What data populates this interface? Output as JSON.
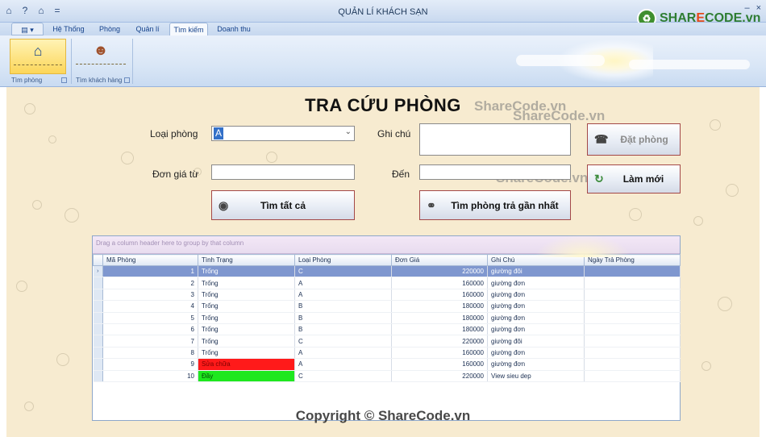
{
  "window": {
    "title": "QUẢN LÍ KHÁCH SẠN"
  },
  "logo": {
    "text_a": "SHAR",
    "text_o": "E",
    "text_b": "CODE.vn"
  },
  "ribbon_tabs": [
    {
      "label": "Hệ Thống"
    },
    {
      "label": "Phòng"
    },
    {
      "label": "Quản lí"
    },
    {
      "label": "Tìm kiếm"
    },
    {
      "label": "Doanh thu"
    }
  ],
  "ribbon": {
    "group1_label": "Tìm phòng",
    "group2_label": "Tìm khách hàng"
  },
  "form": {
    "heading": "TRA CỨU PHÒNG",
    "loai_phong_label": "Loại phòng",
    "loai_phong_value": "A",
    "ghi_chu_label": "Ghi chú",
    "don_gia_tu_label": "Đơn giá từ",
    "den_label": "Đến",
    "don_gia_tu_value": "",
    "den_value": "",
    "ghi_chu_value": ""
  },
  "buttons": {
    "dat_phong": "Đặt phòng",
    "lam_moi": "Làm mới",
    "tim_tat_ca": "Tìm tất cả",
    "tim_phong_tra_gan_nhat": "Tìm phòng trả gần nhất"
  },
  "watermarks": {
    "w1": "ShareCode.vn",
    "w2": "ShareCode.vn",
    "w3": "ShareCode.vn",
    "copyright": "Copyright © ShareCode.vn"
  },
  "grid": {
    "group_panel_text": "Drag a column header here to group by that column",
    "columns": [
      "Mã Phòng",
      "Tình Trạng",
      "Loại Phòng",
      "Đơn Giá",
      "Ghi Chú",
      "Ngày Trả Phòng"
    ],
    "rows": [
      {
        "ma": "1",
        "tinh_trang": "Trống",
        "loai": "C",
        "gia": "220000",
        "ghi_chu": "giường đôi",
        "ngay_tra": ""
      },
      {
        "ma": "2",
        "tinh_trang": "Trống",
        "loai": "A",
        "gia": "160000",
        "ghi_chu": "giường đơn",
        "ngay_tra": ""
      },
      {
        "ma": "3",
        "tinh_trang": "Trống",
        "loai": "A",
        "gia": "160000",
        "ghi_chu": "giường đơn",
        "ngay_tra": ""
      },
      {
        "ma": "4",
        "tinh_trang": "Trống",
        "loai": "B",
        "gia": "180000",
        "ghi_chu": "giường đơn",
        "ngay_tra": ""
      },
      {
        "ma": "5",
        "tinh_trang": "Trống",
        "loai": "B",
        "gia": "180000",
        "ghi_chu": "giường đơn",
        "ngay_tra": ""
      },
      {
        "ma": "6",
        "tinh_trang": "Trống",
        "loai": "B",
        "gia": "180000",
        "ghi_chu": "giường đơn",
        "ngay_tra": ""
      },
      {
        "ma": "7",
        "tinh_trang": "Trống",
        "loai": "C",
        "gia": "220000",
        "ghi_chu": "giường đôi",
        "ngay_tra": ""
      },
      {
        "ma": "8",
        "tinh_trang": "Trống",
        "loai": "A",
        "gia": "160000",
        "ghi_chu": "giường đơn",
        "ngay_tra": ""
      },
      {
        "ma": "9",
        "tinh_trang": "Sửa chữa",
        "loai": "A",
        "gia": "160000",
        "ghi_chu": "giường đơn",
        "ngay_tra": ""
      },
      {
        "ma": "10",
        "tinh_trang": "Đầy",
        "loai": "C",
        "gia": "220000",
        "ghi_chu": "View sieu dep",
        "ngay_tra": ""
      }
    ],
    "status_colors": {
      "Sửa chữa": "#ff1a1a",
      "Đầy": "#1ee81e"
    },
    "current_row_indicator": "›"
  }
}
